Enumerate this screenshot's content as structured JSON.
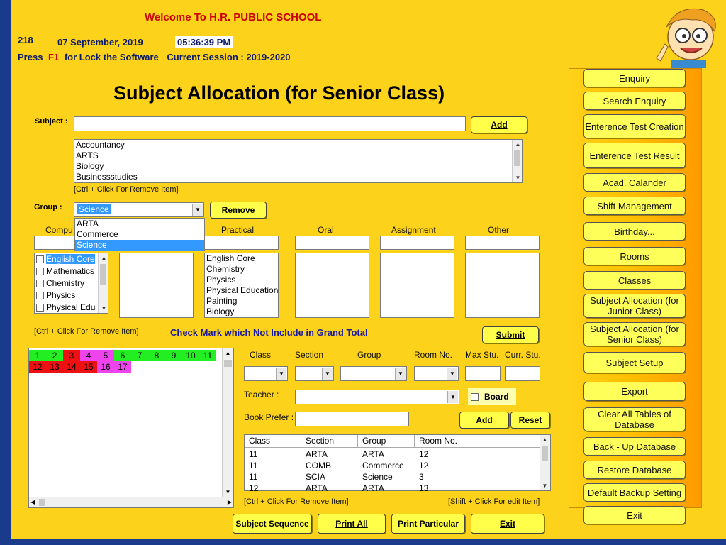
{
  "header": {
    "welcome": "Welcome To  H.R. PUBLIC SCHOOL",
    "code": "218",
    "date": "07 September, 2019",
    "time": "05:36:39 PM",
    "press": "Press",
    "f1": "F1",
    "lock_text": "for Lock the Software",
    "session": "Current Session : 2019-2020"
  },
  "page_title": "Subject Allocation (for Senior Class)",
  "subject": {
    "label": "Subject :",
    "add_label": "Add",
    "list": [
      "Accountancy",
      "ARTS",
      "Biology",
      "Businessstudies"
    ],
    "hint": "[Ctrl + Click For Remove Item]"
  },
  "group": {
    "label": "Group :",
    "selected": "Science",
    "options": [
      "ARTA",
      "Commerce",
      "Science"
    ],
    "remove_label": "Remove"
  },
  "columns": {
    "compulsory": "Compu",
    "practical": "Practical",
    "oral": "Oral",
    "assignment": "Assignment",
    "other": "Other"
  },
  "compulsory_list": [
    "English Core",
    "Mathematics",
    "Chemistry",
    "Physics",
    "Physical Edu"
  ],
  "practical_list": [
    "English Core",
    "Chemistry",
    "Physics",
    "Physical Education",
    "Painting",
    "Biology"
  ],
  "hint2": "[Ctrl + Click For Remove Item]",
  "check_mark_text": "Check Mark which Not Include in Grand Total",
  "submit_label": "Submit",
  "grid_numbers": {
    "row1": [
      "1",
      "2",
      "3",
      "4",
      "5",
      "6",
      "7",
      "8",
      "9",
      "10",
      "11"
    ],
    "row2": [
      "12",
      "13",
      "14",
      "15",
      "16",
      "17"
    ]
  },
  "colors": {
    "green": "#22ee22",
    "red": "#ee1111",
    "magenta": "#ee44ee",
    "panel_yellow": "#fdd21a",
    "button_yellow": "#ffff4a"
  },
  "form": {
    "class": "Class",
    "section": "Section",
    "group": "Group",
    "room": "Room No.",
    "max_stu": "Max Stu.",
    "curr_stu": "Curr. Stu.",
    "teacher": "Teacher :",
    "board": "Board",
    "book_prefer": "Book Prefer :",
    "add": "Add",
    "reset": "Reset"
  },
  "table": {
    "headers": [
      "Class",
      "Section",
      "Group",
      "Room No."
    ],
    "rows": [
      [
        "11",
        "ARTA",
        "ARTA",
        "12"
      ],
      [
        "11",
        "COMB",
        "Commerce",
        "12"
      ],
      [
        "11",
        "SCIA",
        "Science",
        "3"
      ],
      [
        "12",
        "ARTA",
        "ARTA",
        "13"
      ]
    ]
  },
  "hint3": "[Ctrl + Click For Remove Item]",
  "hint4": "[Shift + Click For edit Item]",
  "bottom_buttons": [
    "Subject Sequence",
    "Print All",
    "Print Particular",
    "Exit"
  ],
  "sidebar": [
    "Enquiry",
    "Search Enquiry",
    "Enterence Test Creation",
    "Enterence Test Result",
    "Acad. Calander",
    "Shift Management",
    "Birthday...",
    "Rooms",
    "Classes",
    "Subject Allocation (for Junior Class)",
    "Subject Allocation (for Senior Class)",
    "Subject Setup",
    "Export",
    "Clear All Tables of Database",
    "Back - Up Database",
    "Restore Database",
    "Default Backup Setting",
    "Exit"
  ]
}
